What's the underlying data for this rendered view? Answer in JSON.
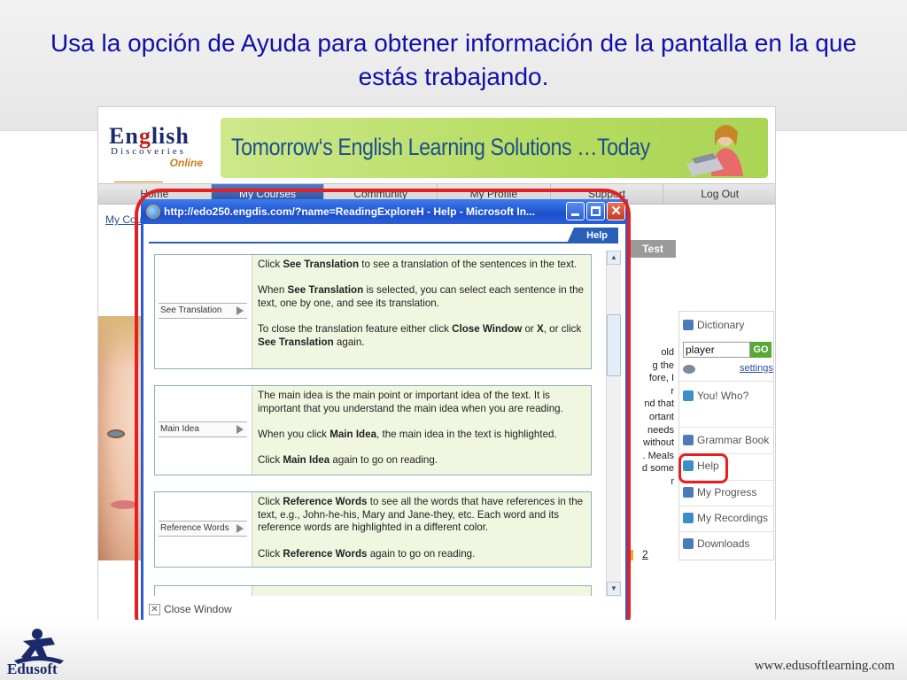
{
  "slide": {
    "title": "Usa la opción de Ayuda para obtener información de la pantalla en la que estás trabajando.",
    "footer_url": "www.edusoftlearning.com",
    "brand": "Edusoft"
  },
  "site": {
    "logo": {
      "line1": "English",
      "line2": "Discoveries",
      "line3": "Online"
    },
    "banner_text": "Tomorrow‘s English Learning Solutions …Today",
    "nav": [
      "Home",
      "My Courses",
      "Community",
      "My Profile",
      "Support",
      "Log Out"
    ],
    "active_nav": "My Courses",
    "breadcrumb": "My Cou",
    "test_tab": "Test",
    "background_text": [
      "old",
      "g the",
      "fore, I",
      "r",
      "nd that",
      "ortant",
      "needs",
      "without",
      ". Meals",
      "d some",
      "r"
    ],
    "pager": {
      "page": "2"
    }
  },
  "sidebar": {
    "dictionary": "Dictionary",
    "search_value": "player",
    "go": "GO",
    "settings": "settings",
    "you_who": "You! Who?",
    "grammar_book": "Grammar Book",
    "help": "Help",
    "my_progress": "My Progress",
    "my_recordings": "My Recordings",
    "downloads": "Downloads"
  },
  "popup": {
    "title": "http://edo250.engdis.com/?name=ReadingExploreH - Help - Microsoft In...",
    "help_tab": "Help",
    "close_window": "Close Window",
    "cards": [
      {
        "button": "See Translation",
        "paragraphs": [
          [
            "Click ",
            "See Translation",
            " to see a translation of the sentences in the text."
          ],
          [
            "When ",
            "See Translation",
            " is selected, you can select each sentence in the text, one by one, and see its translation."
          ],
          [
            "To close the translation feature either click ",
            "Close Window",
            " or ",
            "X",
            ", or click ",
            "See Translation",
            " again."
          ]
        ]
      },
      {
        "button": "Main Idea",
        "paragraphs": [
          [
            "The main idea is the main point or important idea of the text. It is important that you understand the main idea when you are reading."
          ],
          [
            "When you click ",
            "Main Idea",
            ", the main idea in the text is highlighted."
          ],
          [
            "Click ",
            "Main Idea",
            " again to go on reading."
          ]
        ]
      },
      {
        "button": "Reference Words",
        "paragraphs": [
          [
            "Click ",
            "Reference Words",
            " to see all the words that have references in the text, e.g., John-he-his, Mary and Jane-they, etc. Each word and its reference words are highlighted in a different color."
          ],
          [
            "Click ",
            "Reference Words",
            " again to go on reading."
          ]
        ]
      }
    ]
  },
  "colors": {
    "title": "#1010a8",
    "highlight": "#e52020",
    "nav_active": "#2a4f9a",
    "card_bg": "#f1f6e0"
  }
}
